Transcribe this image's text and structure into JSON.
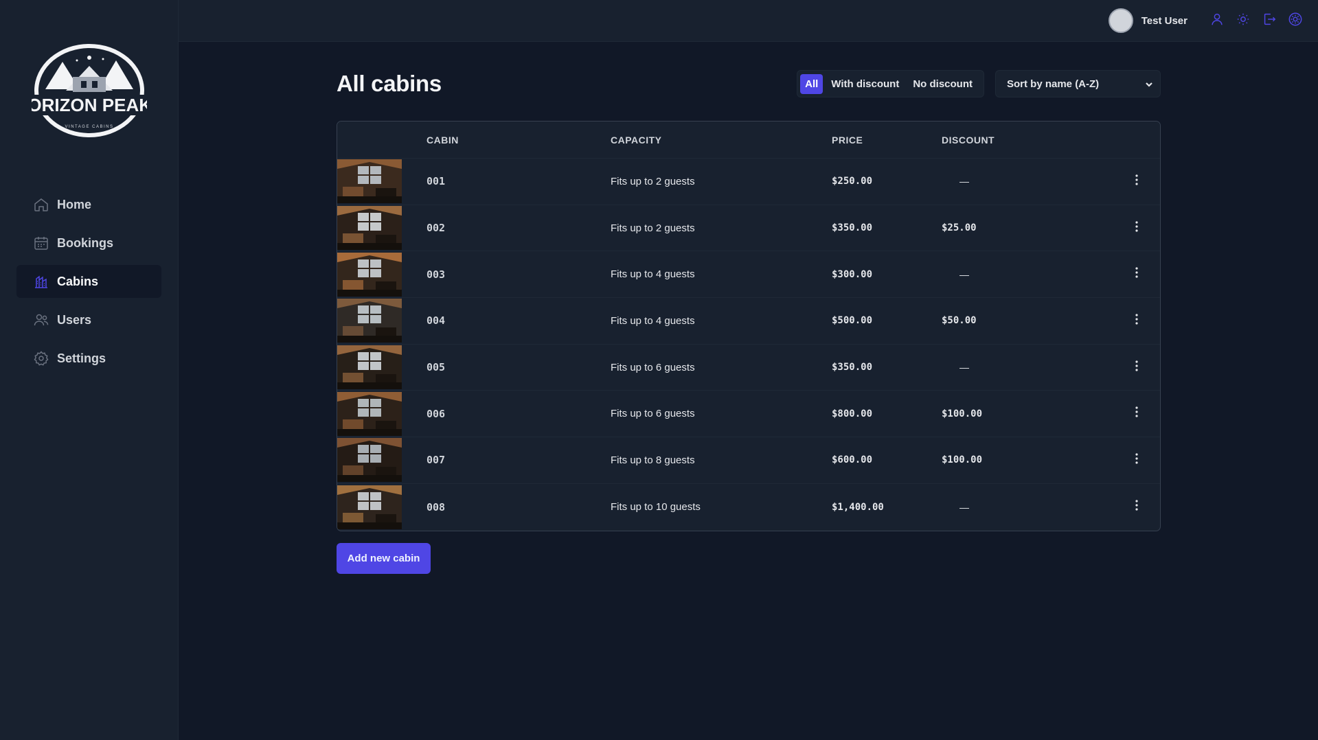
{
  "brand": {
    "name": "HORIZON PEAKS",
    "tagline": "VINTAGE CABINS"
  },
  "sidebar": {
    "items": [
      {
        "label": "Home",
        "icon": "home-icon",
        "active": false
      },
      {
        "label": "Bookings",
        "icon": "calendar-icon",
        "active": false
      },
      {
        "label": "Cabins",
        "icon": "cabins-icon",
        "active": true
      },
      {
        "label": "Users",
        "icon": "users-icon",
        "active": false
      },
      {
        "label": "Settings",
        "icon": "gear-icon",
        "active": false
      }
    ]
  },
  "header": {
    "username": "Test User",
    "buttons": [
      "user-icon",
      "sun-icon",
      "logout-icon",
      "settings-gear-icon"
    ]
  },
  "main": {
    "title": "All cabins",
    "filters": [
      {
        "label": "All",
        "active": true
      },
      {
        "label": "With discount",
        "active": false
      },
      {
        "label": "No discount",
        "active": false
      }
    ],
    "sort": {
      "selected": "Sort by name (A-Z)"
    },
    "table": {
      "headers": [
        "",
        "Cabin",
        "Capacity",
        "Price",
        "Discount",
        ""
      ],
      "rows": [
        {
          "name": "001",
          "capacity": "Fits up to 2 guests",
          "price": "$250.00",
          "discount": "—"
        },
        {
          "name": "002",
          "capacity": "Fits up to 2 guests",
          "price": "$350.00",
          "discount": "$25.00"
        },
        {
          "name": "003",
          "capacity": "Fits up to 4 guests",
          "price": "$300.00",
          "discount": "—"
        },
        {
          "name": "004",
          "capacity": "Fits up to 4 guests",
          "price": "$500.00",
          "discount": "$50.00"
        },
        {
          "name": "005",
          "capacity": "Fits up to 6 guests",
          "price": "$350.00",
          "discount": "—"
        },
        {
          "name": "006",
          "capacity": "Fits up to 6 guests",
          "price": "$800.00",
          "discount": "$100.00"
        },
        {
          "name": "007",
          "capacity": "Fits up to 8 guests",
          "price": "$600.00",
          "discount": "$100.00"
        },
        {
          "name": "008",
          "capacity": "Fits up to 10 guests",
          "price": "$1,400.00",
          "discount": "—"
        }
      ]
    },
    "add_button": "Add new cabin"
  },
  "colors": {
    "accent": "#4f46e5",
    "background": "#111827",
    "surface": "#18212f"
  }
}
